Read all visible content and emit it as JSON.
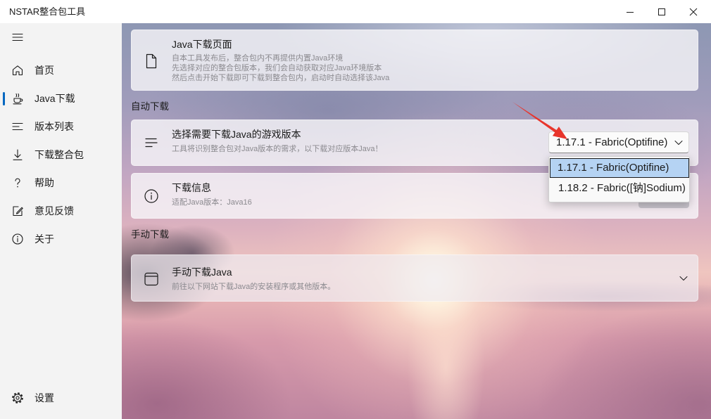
{
  "window": {
    "title": "NSTAR整合包工具",
    "controls": [
      "minimize-icon",
      "maximize-icon",
      "close-icon"
    ]
  },
  "colors": {
    "accent": "#0067c0",
    "option_highlight": "#b5d3f3",
    "annotation_arrow": "#e8352c"
  },
  "sidebar": {
    "menu_icon": "hamburger-menu-icon",
    "items": [
      {
        "label": "首页",
        "icon": "home-icon",
        "selected": false
      },
      {
        "label": "Java下载",
        "icon": "java-cup-icon",
        "selected": true
      },
      {
        "label": "版本列表",
        "icon": "list-icon",
        "selected": false
      },
      {
        "label": "下载整合包",
        "icon": "download-icon",
        "selected": false
      },
      {
        "label": "帮助",
        "icon": "help-icon",
        "selected": false
      },
      {
        "label": "意见反馈",
        "icon": "feedback-icon",
        "selected": false
      },
      {
        "label": "关于",
        "icon": "info-icon",
        "selected": false
      }
    ],
    "footer_item": {
      "label": "设置",
      "icon": "gear-icon"
    }
  },
  "main": {
    "intro_card": {
      "icon": "file-icon",
      "title": "Java下载页面",
      "lines": [
        "自本工具发布后，整合包内不再提供内置Java环境",
        "先选择对应的整合包版本，我们会自动获取对应Java环境版本",
        "然后点击开始下载即可下载到整合包内，启动时自动选择该Java"
      ]
    },
    "auto_section": {
      "header": "自动下载",
      "version_card": {
        "icon": "align-left-icon",
        "title": "选择需要下载Java的游戏版本",
        "description": "工具将识别整合包对Java版本的需求，以下载对应版本Java！",
        "selected_version": "1.17.1 - Fabric(Optifine)",
        "dropdown_open": true,
        "highlighted_index": 0,
        "options": [
          "1.17.1 - Fabric(Optifine)",
          "1.18.2 - Fabric([钠]Sodium)"
        ]
      },
      "info_card": {
        "icon": "info-circle-icon",
        "title": "下载信息",
        "description": "适配Java版本：Java16"
      }
    },
    "manual_section": {
      "header": "手动下载",
      "card": {
        "icon": "window-icon",
        "title": "手动下载Java",
        "description": "前往以下网站下载Java的安装程序或其他版本。",
        "expanded": false
      }
    }
  }
}
